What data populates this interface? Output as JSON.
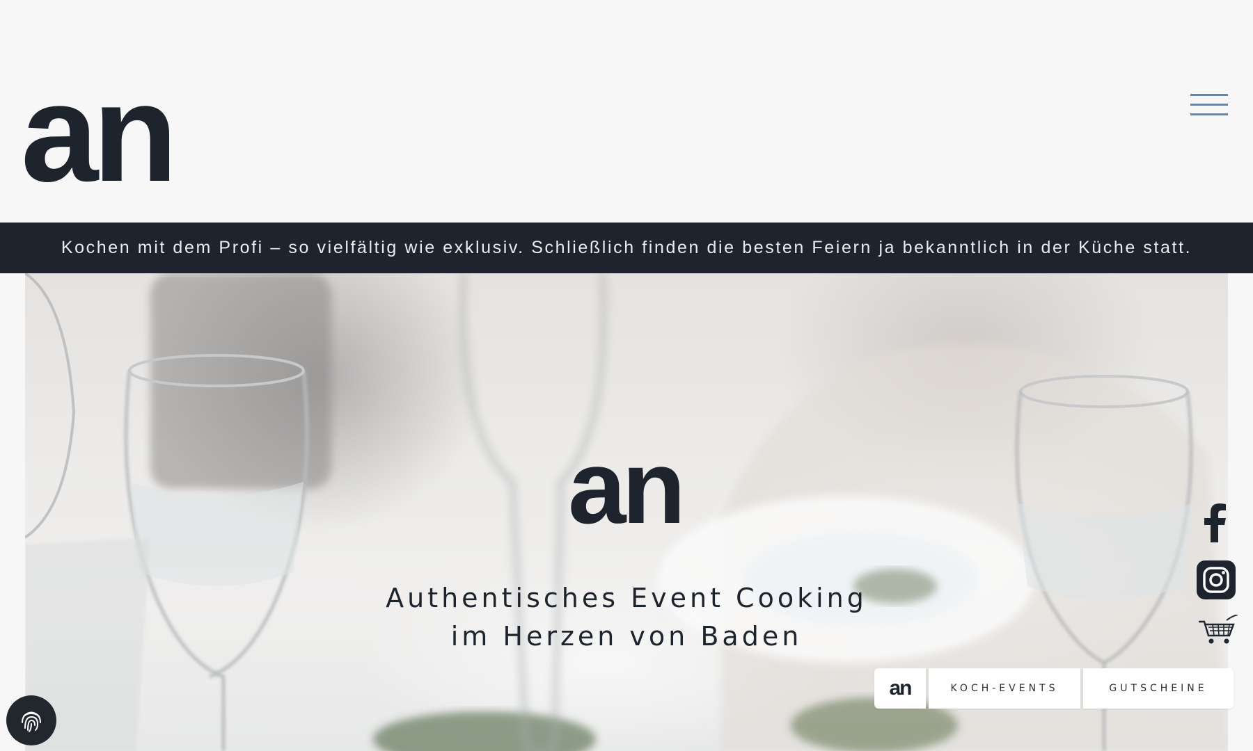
{
  "header": {
    "logo_text": "an",
    "menu_icon": "hamburger-menu-icon"
  },
  "tagline": "Kochen mit dem Profi – so vielfältig wie exklusiv. Schließlich finden die besten Feiern ja bekanntlich in der Küche statt.",
  "hero": {
    "logo_text": "an",
    "title_line1": "Authentisches Event Cooking",
    "title_line2": "im Herzen von Baden",
    "image_description": "blurred table setting with wine glasses"
  },
  "social": {
    "facebook_icon": "facebook-icon",
    "instagram_icon": "instagram-icon",
    "cart_icon": "shopping-cart-icon"
  },
  "bottom_nav": {
    "logo_text": "an",
    "koch_events": "KOCH-EVENTS",
    "gutscheine": "GUTSCHEINE"
  },
  "cookie_button_icon": "fingerprint-icon",
  "colors": {
    "dark": "#1d242d",
    "accent": "#5a87b4",
    "background": "#f7f7f7"
  }
}
